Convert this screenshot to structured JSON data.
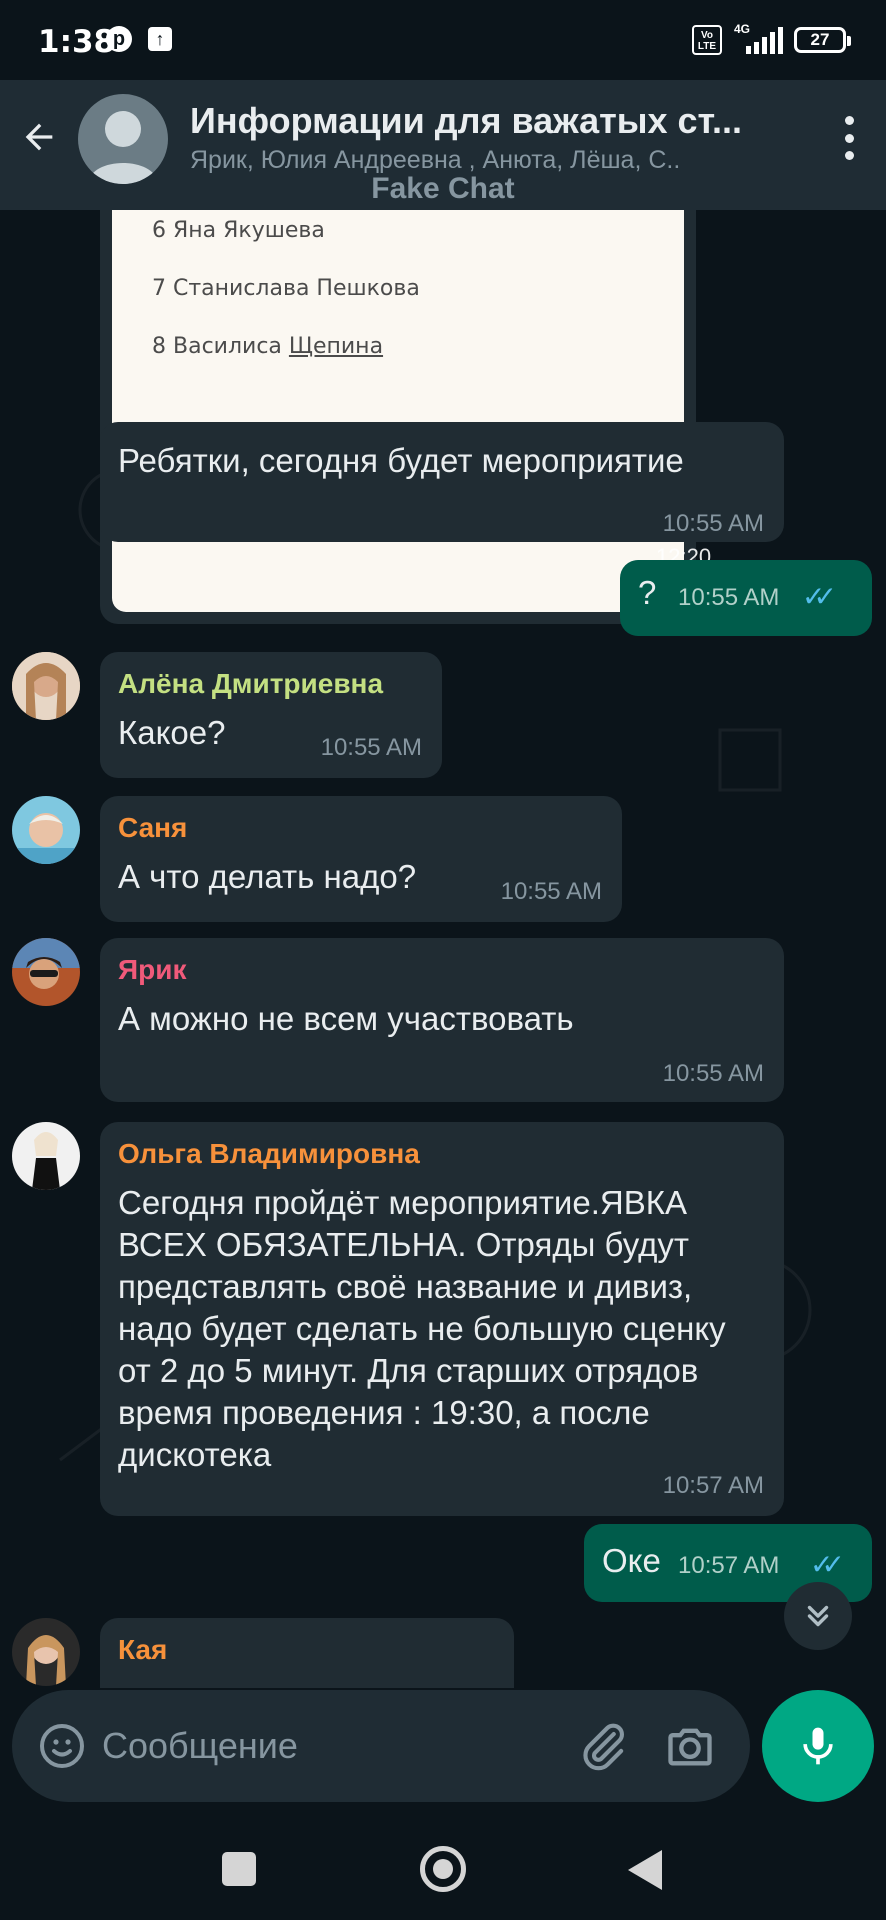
{
  "status_bar": {
    "time": "1:38",
    "network": "4G",
    "volte": "Vo LTE",
    "battery": "27"
  },
  "header": {
    "title": "Информации для важатых ст...",
    "members": "Ярик, Юлия Андреевна , Анюта, Лёша, С..",
    "watermark": "Fake Chat"
  },
  "image_message": {
    "rows": [
      {
        "num": "6",
        "name": "Яна Якушева"
      },
      {
        "num": "7",
        "name": "Станислава Пешкова"
      },
      {
        "num": "8",
        "first": "Василиса",
        "last": "Щепина"
      }
    ],
    "time": "12:20 AM"
  },
  "messages": [
    {
      "id": "m1",
      "direction": "in",
      "text": "Ребятки, сегодня будет мероприятие",
      "time": "10:55 AM"
    },
    {
      "id": "m2",
      "direction": "out",
      "text": "?",
      "time": "10:55 AM"
    },
    {
      "id": "m3",
      "direction": "in",
      "sender": "Алёна Дмитриевна",
      "sender_color": "#c4e082",
      "text": "Какое?",
      "time": "10:55 AM"
    },
    {
      "id": "m4",
      "direction": "in",
      "sender": "Саня",
      "sender_color": "#f7913b",
      "text": "А что делать надо?",
      "time": "10:55 AM"
    },
    {
      "id": "m5",
      "direction": "in",
      "sender": "Ярик",
      "sender_color": "#f05a7a",
      "text": "А можно не всем участвовать",
      "time": "10:55 AM"
    },
    {
      "id": "m6",
      "direction": "in",
      "sender": "Ольга Владимировна",
      "sender_color": "#f7913b",
      "text": "Сегодня пройдёт мероприятие.ЯВКА ВСЕХ ОБЯЗАТЕЛЬНА. Отряды будут представлять своё название и дивиз, надо будет сделать не большую сценку от 2 до 5 минут. Для старших отрядов время проведения : 19:30, а после дискотека",
      "time": "10:57 AM"
    },
    {
      "id": "m7",
      "direction": "out",
      "text": "Оке",
      "time": "10:57 AM"
    },
    {
      "id": "m8",
      "direction": "in",
      "sender": "Кая",
      "sender_color": "#f7913b"
    }
  ],
  "composer": {
    "placeholder": "Сообщение"
  },
  "colors": {
    "background": "#0b141a",
    "header": "#1f2c34",
    "incoming_bubble": "#202c33",
    "outgoing_bubble": "#005c4b",
    "accent": "#00a884",
    "read_ticks": "#53bdeb"
  },
  "icons": [
    "back-arrow-icon",
    "group-avatar-icon",
    "more-vert-icon",
    "emoji-icon",
    "paperclip-icon",
    "camera-icon",
    "mic-icon",
    "chevron-double-down-icon",
    "double-check-icon"
  ]
}
